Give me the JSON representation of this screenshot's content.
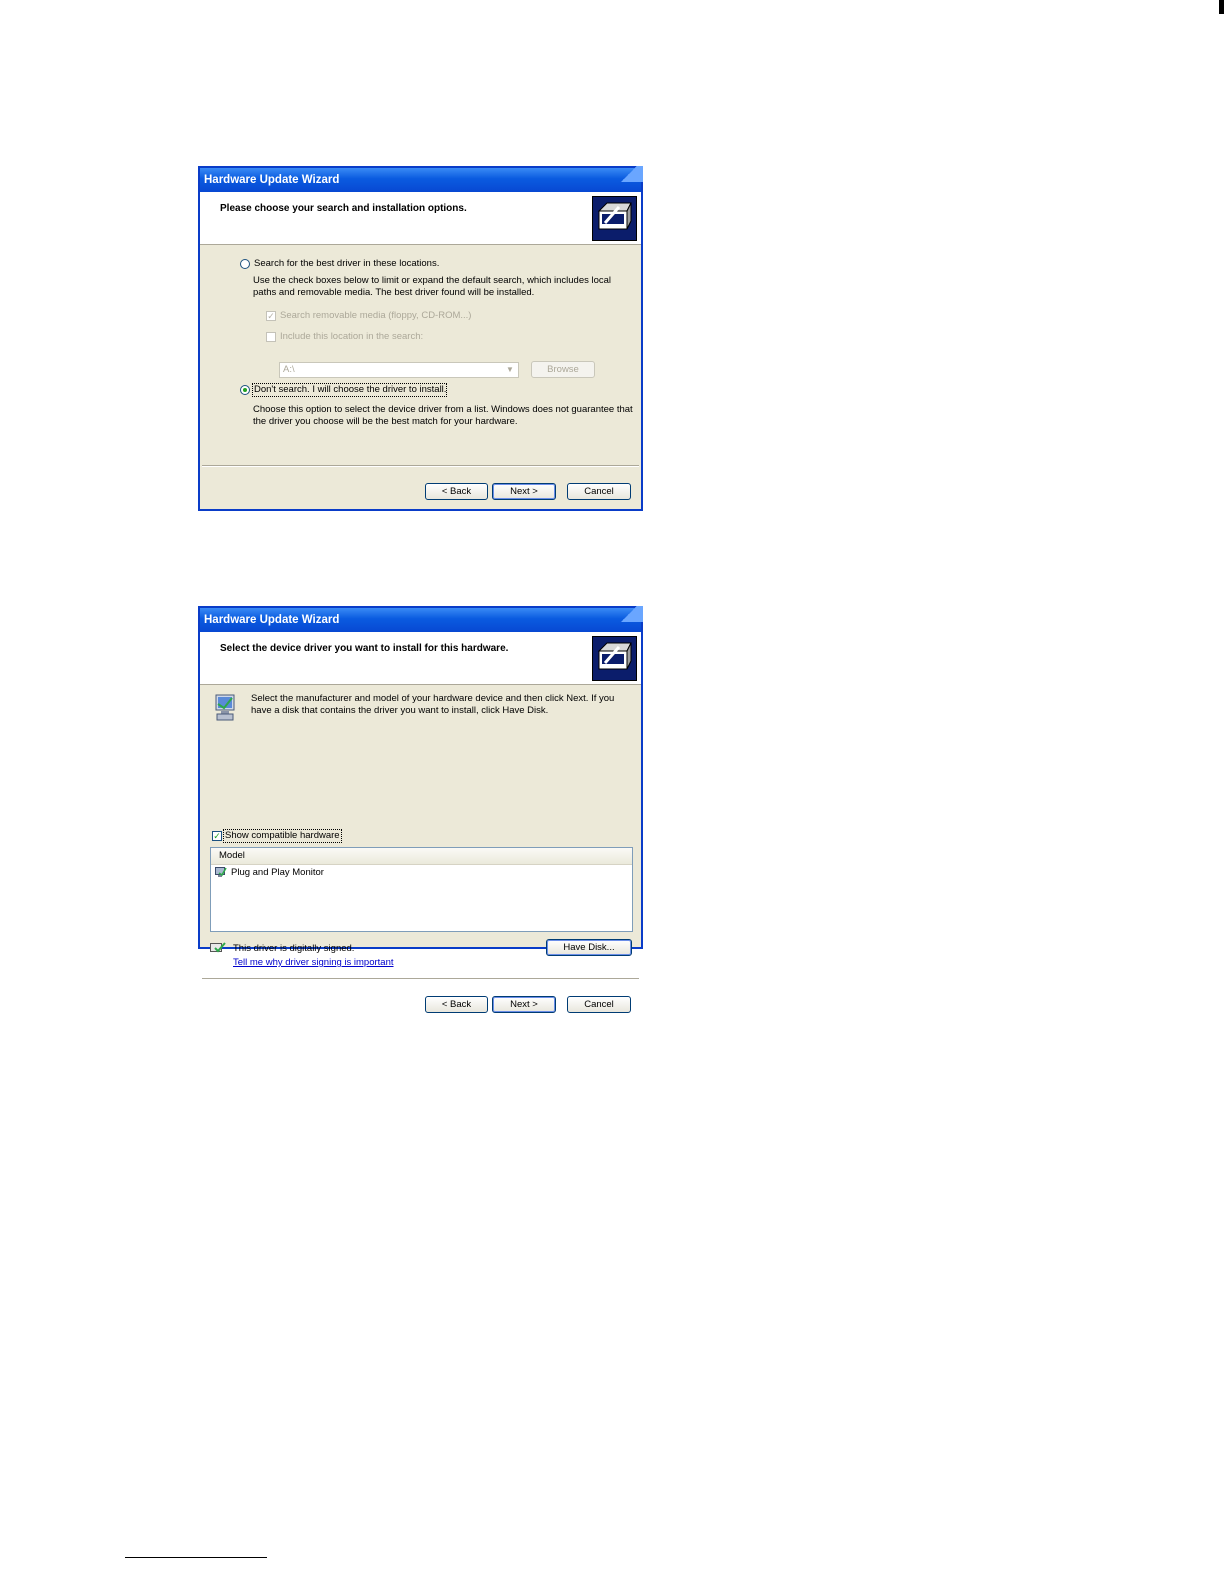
{
  "dialog1": {
    "title": "Hardware Update Wizard",
    "heading": "Please choose your search and installation options.",
    "option_search": "Search for the best driver in these locations.",
    "option_search_desc": "Use the check boxes below to limit or expand the default search, which includes local paths and removable media. The best driver found will be installed.",
    "cb_removable": "Search removable media (floppy, CD-ROM...)",
    "cb_include": "Include this location in the search:",
    "path_value": "A:\\",
    "browse_label": "Browse",
    "option_dont_search": "Don't search. I will choose the driver to install.",
    "option_dont_search_desc": "Choose this option to select the device driver from a list. Windows does not guarantee that the driver you choose will be the best match for your hardware.",
    "back_label": "< Back",
    "next_label": "Next >",
    "cancel_label": "Cancel"
  },
  "dialog2": {
    "title": "Hardware Update Wizard",
    "heading": "Select the device driver you want to install for this hardware.",
    "intro": "Select the manufacturer and model of your hardware device and then click Next. If you have a disk that contains the driver you want to install, click Have Disk.",
    "show_compatible": "Show compatible hardware",
    "column_header": "Model",
    "models": [
      "Plug and Play Monitor"
    ],
    "signed_text": "This driver is digitally signed.",
    "signing_link": "Tell me why driver signing is important",
    "have_disk_label": "Have Disk...",
    "back_label": "< Back",
    "next_label": "Next >",
    "cancel_label": "Cancel"
  },
  "colors": {
    "titlebar": "#0a5be0",
    "dialog_bg": "#ece9d8",
    "link": "#0000cc"
  }
}
